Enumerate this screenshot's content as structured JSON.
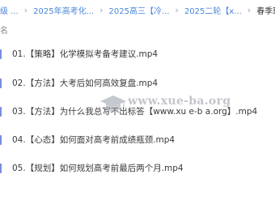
{
  "breadcrumb": {
    "items": [
      "级 ...",
      "2025年高考化...",
      "2025高三【冷...",
      "2025二轮【x..."
    ],
    "current": "春季班"
  },
  "list_header": {
    "name_label": "名"
  },
  "files": [
    {
      "name": "01.【策略】化学模拟考备考建议.mp4"
    },
    {
      "name": "02.【方法】大考后如何高效复盘.mp4"
    },
    {
      "name": "03.【方法】为什么我总写不出标答【www.xu e-b a.org】.mp4"
    },
    {
      "name": "04.【心态】如何面对高考前成绩瓶颈.mp4"
    },
    {
      "name": "05.【规划】如何规划高考前最后两个月.mp4"
    }
  ],
  "watermark": {
    "text": "www.xue-ba.org",
    "icon": "graduation-cap-icon"
  },
  "colors": {
    "link": "#4a86d8",
    "file_icon": "#7b8cde",
    "text": "#3a3a3a",
    "muted": "#8a8a8a"
  }
}
